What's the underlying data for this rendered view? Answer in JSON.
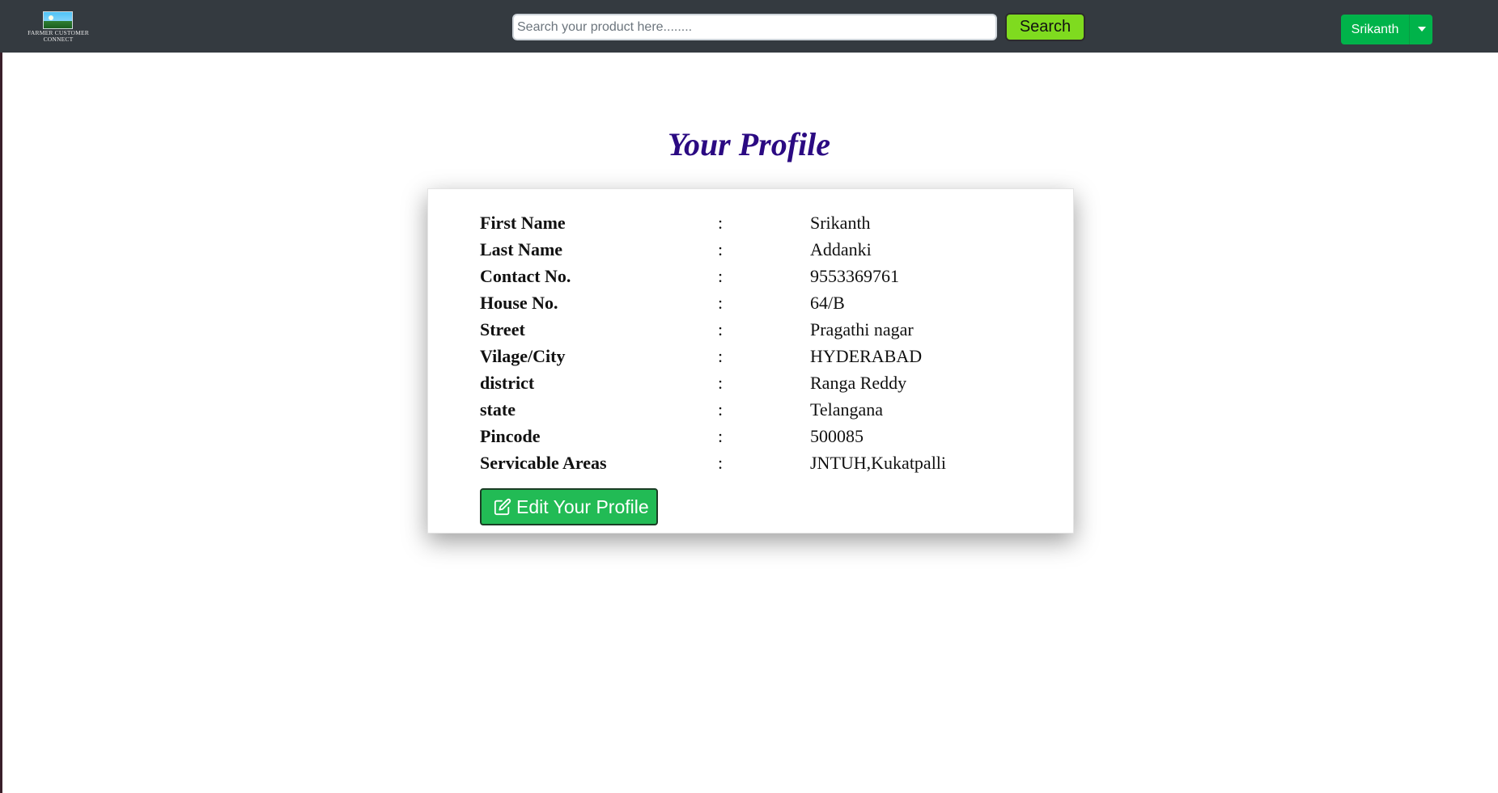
{
  "navbar": {
    "logo_text_line1": "FARMER CUSTOMER",
    "logo_text_line2": "CONNECT",
    "search_placeholder": "Search your product here........",
    "search_label": "Search",
    "user_name": "Srikanth"
  },
  "colors": {
    "navbar_bg": "#343a40",
    "search_button": "#7fdb1f",
    "user_button": "#00b34a",
    "title": "#2b0a82",
    "edit_button": "#22bb55"
  },
  "profile": {
    "title": "Your Profile",
    "separator": ":",
    "fields": [
      {
        "label": "First Name",
        "value": "Srikanth"
      },
      {
        "label": "Last Name",
        "value": "Addanki"
      },
      {
        "label": "Contact No.",
        "value": "9553369761"
      },
      {
        "label": "House No.",
        "value": "64/B"
      },
      {
        "label": "Street",
        "value": "Pragathi nagar"
      },
      {
        "label": "Vilage/City",
        "value": "HYDERABAD"
      },
      {
        "label": "district",
        "value": "Ranga Reddy"
      },
      {
        "label": "state",
        "value": "Telangana"
      },
      {
        "label": "Pincode",
        "value": "500085"
      },
      {
        "label": "Servicable Areas",
        "value": "JNTUH,Kukatpalli"
      }
    ],
    "edit_label": "Edit Your Profile",
    "edit_icon": "edit-icon"
  }
}
